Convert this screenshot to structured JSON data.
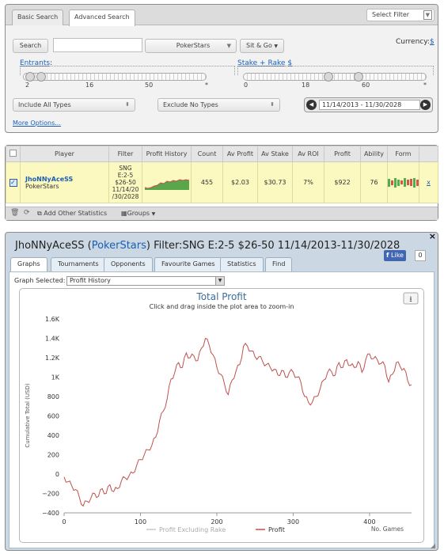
{
  "search_panel": {
    "tabs": [
      "Basic Search",
      "Advanced Search"
    ],
    "select_filter": "Select Filter",
    "search_button": "Search",
    "search_input_value": "",
    "site_select": "PokerStars",
    "game_type_button": "Sit & Go",
    "currency_label": "Currency:",
    "currency_value": "$",
    "entrants_label": "Entrants",
    "entrants_ticks": [
      "2",
      "16",
      "50",
      "*"
    ],
    "entrants_range": [
      2,
      5
    ],
    "stake_label": "Stake + Rake",
    "stake_currency": "$",
    "stake_ticks": [
      "0",
      "18",
      "60",
      "*"
    ],
    "stake_range": [
      26,
      50
    ],
    "include_types": "Include All Types",
    "exclude_types": "Exclude No Types",
    "date_range": "11/14/2013 - 11/30/2028",
    "more_options": "More Options..."
  },
  "results": {
    "headers": [
      "",
      "Player",
      "Filter",
      "Profit History",
      "Count",
      "Av Profit",
      "Av Stake",
      "Av ROI",
      "Profit",
      "Ability",
      "Form"
    ],
    "row": {
      "checked": true,
      "player": "JhoNNyAceSS",
      "site": "PokerStars",
      "filter_lines": [
        "SNG",
        "E:2-5",
        "$26-50",
        "11/14/20",
        "/30/2028"
      ],
      "count": "455",
      "av_profit": "$2.03",
      "av_stake": "$30.73",
      "av_roi": "7%",
      "profit": "$922",
      "ability": "76",
      "remove": "x",
      "form": [
        "w",
        "l",
        "w",
        "w",
        "l",
        "w",
        "l",
        "l",
        "w",
        "l"
      ]
    },
    "footer": {
      "add_stats": "Add Other Statistics",
      "groups": "Groups"
    }
  },
  "detail": {
    "title_player": "JhoNNyAceSS",
    "title_site": "PokerStars",
    "title_filter": "Filter:SNG E:2-5 $26-50 11/14/2013-11/30/2028",
    "title_open_paren": "(",
    "title_close_paren": ")",
    "like_label": "Like",
    "like_count": "0",
    "close": "×",
    "tabs": [
      "Graphs",
      "Tournaments",
      "Opponents",
      "Favourite Games",
      "Statistics",
      "Find"
    ],
    "graph_selected_label": "Graph Selected:",
    "graph_selected_value": "Profit History"
  },
  "colors": {
    "profit_line": "#c0504d",
    "excluding_rake_line": "#c8c8c8",
    "title": "#3a6e9c",
    "form_win": "#4caf50",
    "form_loss": "#d9534f"
  },
  "chart_data": {
    "type": "line",
    "title": "Total Profit",
    "subtitle": "Click and drag inside the plot area to zoom-in",
    "xlabel": "No. Games",
    "ylabel": "Cumulative Total (USD)",
    "xlim": [
      0,
      455
    ],
    "ylim": [
      -400,
      1600
    ],
    "x_ticks": [
      "0",
      "100",
      "200",
      "300",
      "400"
    ],
    "y_ticks": [
      "−400",
      "−200",
      "0",
      "200",
      "400",
      "600",
      "800",
      "1K",
      "1.2K",
      "1.4K",
      "1.6K"
    ],
    "legend": [
      {
        "name": "Profit Excluding Rake",
        "color": "#c8c8c8"
      },
      {
        "name": "Profit",
        "color": "#c0504d"
      }
    ],
    "series": [
      {
        "name": "Profit",
        "x": [
          0,
          5,
          10,
          15,
          20,
          25,
          30,
          35,
          40,
          45,
          50,
          55,
          60,
          65,
          70,
          75,
          80,
          85,
          90,
          95,
          100,
          105,
          110,
          115,
          120,
          125,
          130,
          135,
          140,
          145,
          150,
          155,
          160,
          165,
          170,
          175,
          180,
          185,
          190,
          195,
          200,
          205,
          210,
          215,
          220,
          225,
          230,
          235,
          240,
          245,
          250,
          255,
          260,
          265,
          270,
          275,
          280,
          285,
          290,
          295,
          300,
          305,
          310,
          315,
          320,
          325,
          330,
          335,
          340,
          345,
          350,
          355,
          360,
          365,
          370,
          375,
          380,
          385,
          390,
          395,
          400,
          405,
          410,
          415,
          420,
          425,
          430,
          435,
          440,
          445,
          450,
          455
        ],
        "y": [
          -30,
          -80,
          -120,
          -160,
          -240,
          -330,
          -280,
          -250,
          -200,
          -230,
          -150,
          -200,
          -110,
          -180,
          -150,
          -70,
          -40,
          -20,
          10,
          90,
          150,
          200,
          250,
          300,
          380,
          550,
          650,
          780,
          980,
          1050,
          1150,
          1100,
          1250,
          1200,
          1220,
          1170,
          1300,
          1400,
          1330,
          1230,
          1100,
          1030,
          930,
          820,
          970,
          1060,
          1130,
          1320,
          1320,
          1270,
          1210,
          1210,
          1160,
          1130,
          1100,
          1080,
          1020,
          1070,
          1000,
          1050,
          1050,
          1000,
          950,
          800,
          740,
          740,
          800,
          870,
          970,
          1050,
          1060,
          1020,
          1150,
          1100,
          1180,
          1120,
          1100,
          1160,
          1050,
          1180,
          1240,
          1190,
          1180,
          1140,
          1120,
          950,
          1030,
          1150,
          1110,
          1090,
          960,
          922
        ]
      }
    ]
  }
}
